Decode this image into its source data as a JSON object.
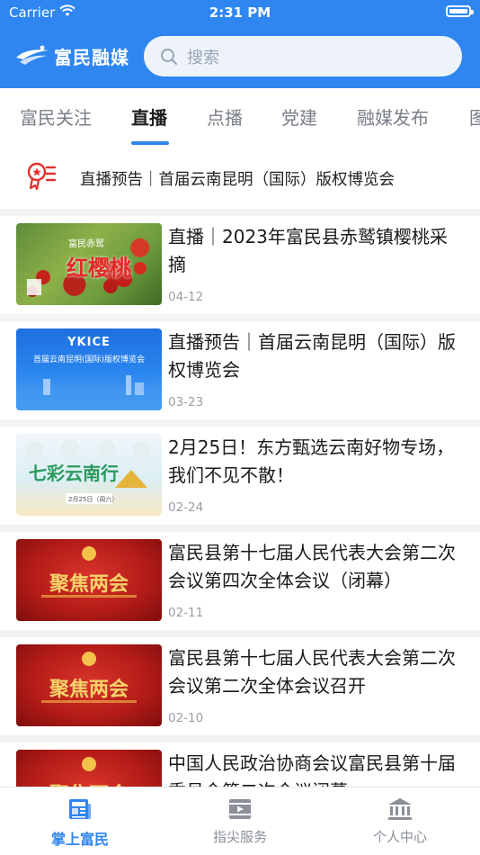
{
  "status_bar": {
    "carrier": "Carrier",
    "time": "2:31 PM"
  },
  "header": {
    "app_name": "富民融媒",
    "search_placeholder": "搜索",
    "accent_color": "#2f86f0"
  },
  "tabs": [
    {
      "label": "富民关注",
      "active": false
    },
    {
      "label": "直播",
      "active": true
    },
    {
      "label": "点播",
      "active": false
    },
    {
      "label": "党建",
      "active": false
    },
    {
      "label": "融媒发布",
      "active": false
    },
    {
      "label": "图",
      "active": false
    }
  ],
  "notice": {
    "icon": "live-badge-icon",
    "text": "直播预告｜首届云南昆明（国际）版权博览会"
  },
  "news": [
    {
      "title": "直播｜2023年富民县赤鹫镇樱桃采摘",
      "date": "04-12",
      "thumb": {
        "theme": "cherry",
        "caption_small": "富民赤鹫",
        "caption_big": "红樱桃"
      }
    },
    {
      "title": "直播预告｜首届云南昆明（国际）版权博览会",
      "date": "03-23",
      "thumb": {
        "theme": "expo",
        "caption_small": "YKICE",
        "caption_big": "首届云南昆明(国际)版权博览会"
      }
    },
    {
      "title": "2月25日！东方甄选云南好物专场，我们不见不散！",
      "date": "02-24",
      "thumb": {
        "theme": "yunnan",
        "caption_small": "2月25日（周六）",
        "caption_big": "七彩云南行"
      }
    },
    {
      "title": "富民县第十七届人民代表大会第二次会议第四次全体会议（闭幕）",
      "date": "02-11",
      "thumb": {
        "theme": "congress",
        "caption_big": "聚焦两会"
      }
    },
    {
      "title": "富民县第十七届人民代表大会第二次会议第二次全体会议召开",
      "date": "02-10",
      "thumb": {
        "theme": "congress",
        "caption_big": "聚焦两会"
      }
    },
    {
      "title": "中国人民政治协商会议富民县第十届委员会第二次会议闭幕",
      "date": "",
      "thumb": {
        "theme": "congress",
        "caption_big": "聚焦两会"
      }
    }
  ],
  "tabbar": [
    {
      "label": "掌上富民",
      "icon": "newspaper-icon",
      "active": true
    },
    {
      "label": "指尖服务",
      "icon": "video-icon",
      "active": false
    },
    {
      "label": "个人中心",
      "icon": "bank-icon",
      "active": false
    }
  ]
}
